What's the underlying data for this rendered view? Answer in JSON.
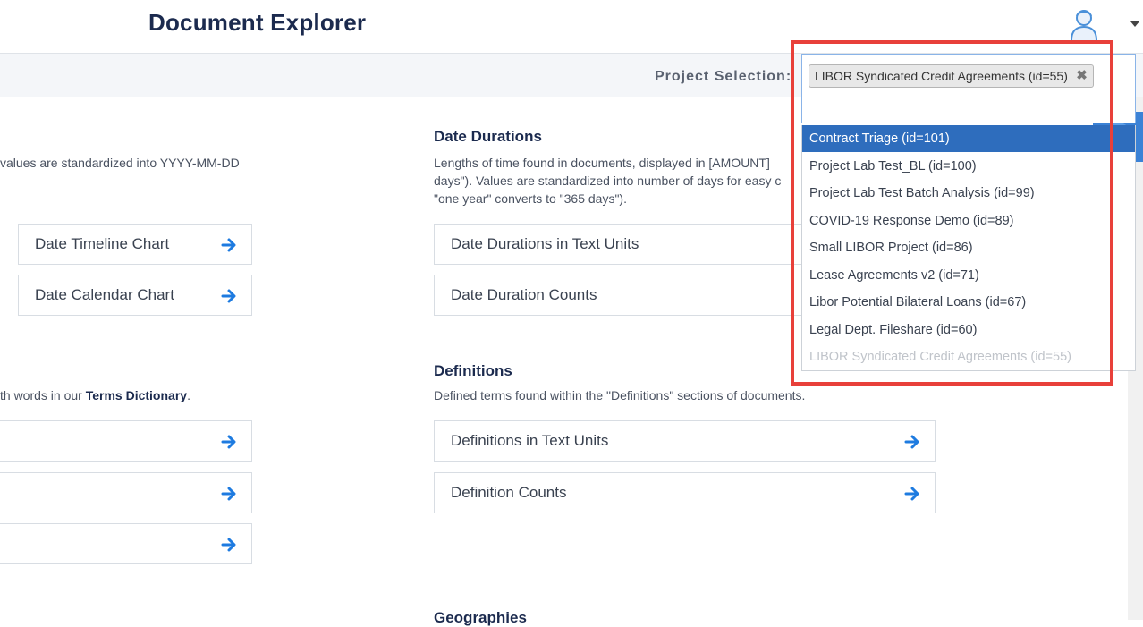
{
  "header": {
    "title": "Document Explorer"
  },
  "project_bar": {
    "label": "Project Selection:"
  },
  "dates": {
    "desc": "values are standardized into YYYY-MM-DD",
    "cards": [
      {
        "label": "Date Timeline Chart"
      },
      {
        "label": "Date Calendar Chart"
      }
    ]
  },
  "date_durations": {
    "title": "Date Durations",
    "desc_line1": "Lengths of time found in documents, displayed in [AMOUNT]",
    "desc_line2": "days\"). Values are standardized into number of days for easy c",
    "desc_line3": "\"one year\" converts to \"365 days\").",
    "cards": [
      {
        "label": "Date Durations in Text Units"
      },
      {
        "label": "Date Duration Counts"
      }
    ]
  },
  "terms": {
    "desc_prefix": "th words in our ",
    "desc_bold": "Terms Dictionary",
    "desc_suffix": "."
  },
  "definitions": {
    "title": "Definitions",
    "desc": "Defined terms found within the \"Definitions\" sections of documents.",
    "cards": [
      {
        "label": "Definitions in Text Units"
      },
      {
        "label": "Definition Counts"
      }
    ]
  },
  "geographies": {
    "title": "Geographies"
  },
  "project_select": {
    "selected_chip": "LIBOR Syndicated Credit Agreements (id=55)",
    "options": [
      {
        "label": "Contract Triage (id=101)",
        "state": "active"
      },
      {
        "label": "Project Lab Test_BL (id=100)",
        "state": "normal"
      },
      {
        "label": "Project Lab Test Batch Analysis (id=99)",
        "state": "normal"
      },
      {
        "label": "COVID-19 Response Demo (id=89)",
        "state": "normal"
      },
      {
        "label": "Small LIBOR Project (id=86)",
        "state": "normal"
      },
      {
        "label": "Lease Agreements v2 (id=71)",
        "state": "normal"
      },
      {
        "label": "Libor Potential Bilateral Loans (id=67)",
        "state": "normal"
      },
      {
        "label": "Legal Dept. Fileshare (id=60)",
        "state": "normal"
      },
      {
        "label": "LIBOR Syndicated Credit Agreements (id=55)",
        "state": "disabled"
      }
    ]
  },
  "colors": {
    "accent": "#2e6dbd",
    "arrow": "#1e7be0",
    "highlight": "#e8403a",
    "title": "#1b2a4e"
  }
}
